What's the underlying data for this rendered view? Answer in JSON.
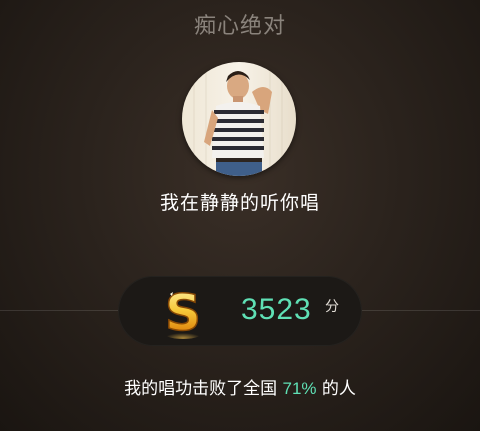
{
  "song": {
    "title": "痴心绝对"
  },
  "singer": {
    "status_text": "我在静静的听你唱"
  },
  "score": {
    "icon": "gold-s-coin-icon",
    "value": "3523",
    "unit": "分"
  },
  "result": {
    "prefix": "我的唱功击败了全国",
    "percent": "71%",
    "suffix": "的人"
  },
  "colors": {
    "accent": "#5fe0b5",
    "title_gray": "#8a837c",
    "pill_bg": "#1c1916"
  }
}
